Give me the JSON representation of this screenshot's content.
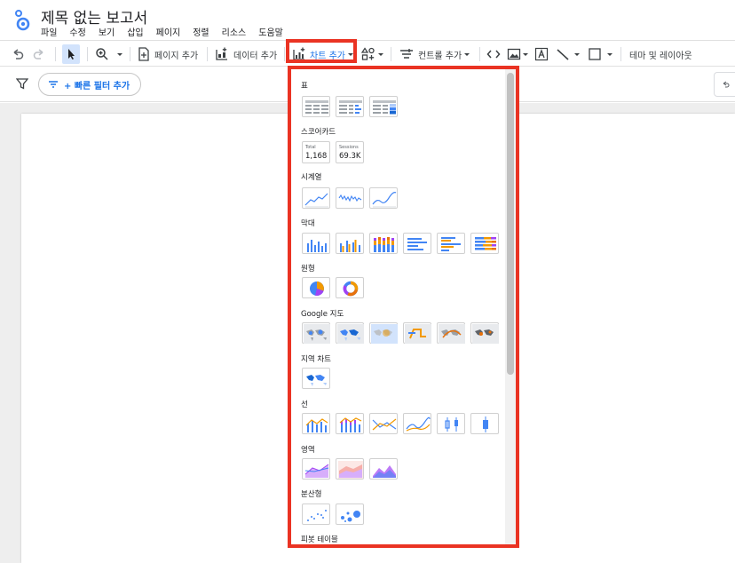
{
  "header": {
    "title": "제목 없는 보고서",
    "menu": [
      "파일",
      "수정",
      "보기",
      "삽입",
      "페이지",
      "정렬",
      "리소스",
      "도움말"
    ]
  },
  "toolbar": {
    "add_page": "페이지 추가",
    "add_data": "데이터 추가",
    "add_chart": "차트 추가",
    "add_control": "컨트롤 추가",
    "theme_layout": "테마 및 레이아웃"
  },
  "filterbar": {
    "quick_filter": "+ 빠른 필터 추가"
  },
  "chart_menu": {
    "sections": {
      "table": "표",
      "scorecard": "스코어카드",
      "timeseries": "시계열",
      "bar": "막대",
      "pie": "원형",
      "geo": "Google 지도",
      "geochart": "지역 차트",
      "line": "선",
      "area": "영역",
      "scatter": "분산형",
      "pivot": "피봇 테이블"
    },
    "scorecards": [
      {
        "label": "Total",
        "value": "1,168"
      },
      {
        "label": "Sessions",
        "value": "69.3K"
      }
    ]
  },
  "colors": {
    "accent": "#1a73e8",
    "highlight": "#ea3323",
    "orange": "#f29900",
    "purple": "#a142f4",
    "pink": "#e8710a"
  }
}
